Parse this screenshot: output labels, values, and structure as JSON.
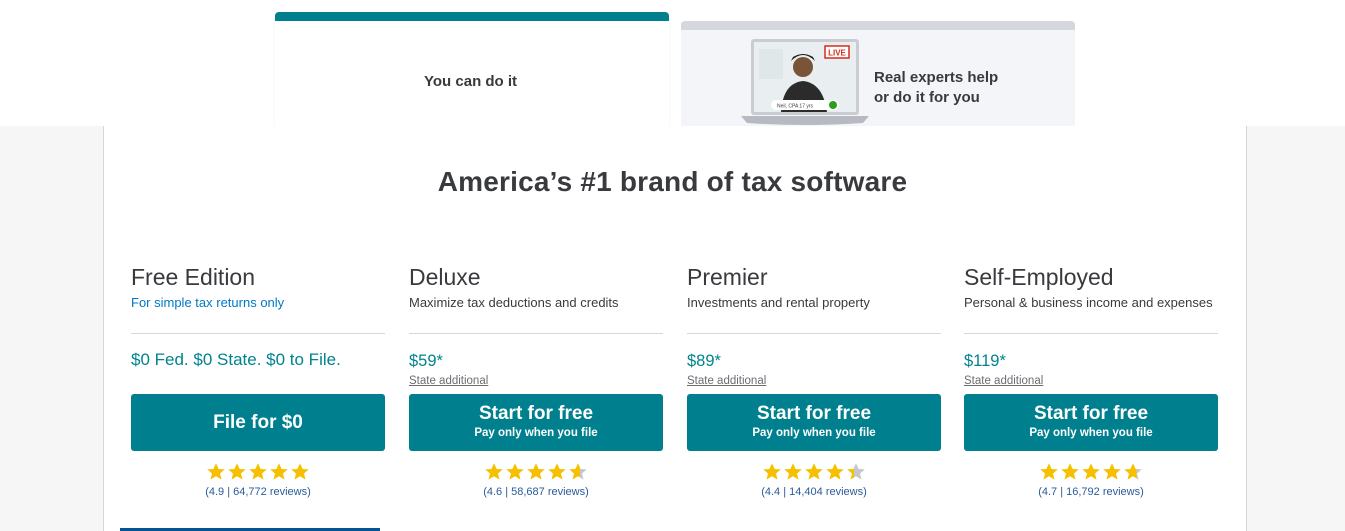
{
  "tabs": {
    "diy_label": "You can do it",
    "expert_line1": "Real experts help",
    "expert_line2": "or do it for you",
    "expert_badge": "LIVE",
    "expert_caption": "Neil, CPA 17 yrs"
  },
  "headline": "America’s #1 brand of tax software",
  "colors": {
    "accent": "#00808f",
    "price": "#00838f",
    "star": "#f6c000",
    "link": "#0077c5"
  },
  "plans": [
    {
      "name": "Free Edition",
      "desc": "For simple tax returns only",
      "price": "$0 Fed. $0 State. $0 to File.",
      "cta_main": "File for $0",
      "rating": 4.9,
      "reviews": "(4.9 | 64,772 reviews)"
    },
    {
      "name": "Deluxe",
      "desc": "Maximize tax deductions and credits",
      "price": "$59*",
      "state": "State additional",
      "cta_main": "Start for free",
      "cta_sub": "Pay only when you file",
      "rating": 4.6,
      "reviews": "(4.6 | 58,687 reviews)"
    },
    {
      "name": "Premier",
      "desc": "Investments and rental property",
      "price": "$89*",
      "state": "State additional",
      "cta_main": "Start for free",
      "cta_sub": "Pay only when you file",
      "rating": 4.4,
      "reviews": "(4.4 | 14,404 reviews)"
    },
    {
      "name": "Self-Employed",
      "desc": "Personal & business income and expenses",
      "price": "$119*",
      "state": "State additional",
      "cta_main": "Start for free",
      "cta_sub": "Pay only when you file",
      "rating": 4.7,
      "reviews": "(4.7 | 16,792 reviews)"
    }
  ]
}
